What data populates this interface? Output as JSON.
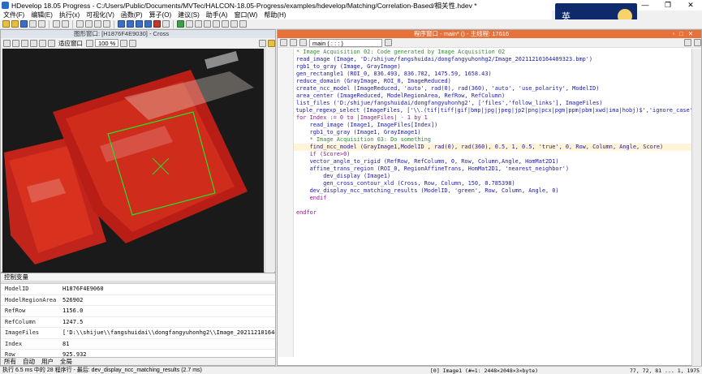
{
  "window": {
    "title": "HDevelop 18.05 Progress - C:/Users/Public/Documents/MVTec/HALCON-18.05-Progress/examples/hdevelop/Matching/Correlation-Based/相关性.hdev *",
    "controls": [
      "—",
      "❐",
      "✕"
    ]
  },
  "menu": [
    "文件(F)",
    "编辑(E)",
    "执行(x)",
    "可视化(V)",
    "函数(P)",
    "算子(O)",
    "建议(S)",
    "助手(A)",
    "窗口(W)",
    "帮助(H)"
  ],
  "ime": {
    "label": "英"
  },
  "graphics": {
    "title": "图形窗口: [H1876F4E9030] - Cross",
    "fit_label": "适应窗口",
    "zoom": "100 %"
  },
  "variables": {
    "title": "控制变量",
    "rows": [
      {
        "name": "ModelID",
        "value": "H1876F4E9060"
      },
      {
        "name": "ModelRegionArea",
        "value": "526902"
      },
      {
        "name": "RefRow",
        "value": "1156.0"
      },
      {
        "name": "RefColumn",
        "value": "1247.5"
      },
      {
        "name": "ImageFiles",
        "value": "['D:\\\\shijue\\\\fangshuidai\\\\dongfangyuhonhg2\\\\Image_20211210164409"
      },
      {
        "name": "Index",
        "value": "81"
      },
      {
        "name": "Row",
        "value": "925.932"
      }
    ],
    "tabs": [
      "所有",
      "自动",
      "用户",
      "全局"
    ]
  },
  "program": {
    "title": "程序窗口 - main* () - 主线程: 17616",
    "procedure": "main ( : : : )",
    "lines": [
      {
        "n": "1",
        "text": "* Image Acquisition 02: Code generated by Image Acquisition 02",
        "style": "comment"
      },
      {
        "n": "2",
        "text": "read_image (Image, 'D:/shijue/fangshuidai/dongfangyuhonhg2/Image_20211210164409323.bmp')",
        "style": ""
      },
      {
        "n": "3",
        "text": "rgb1_to_gray (Image, GrayImage)",
        "style": ""
      },
      {
        "n": "4",
        "text": "gen_rectangle1 (ROI_0, 836.493, 836.702, 1475.59, 1658.43)",
        "style": ""
      },
      {
        "n": "5",
        "text": "reduce_domain (GrayImage, ROI_0, ImageReduced)",
        "style": ""
      },
      {
        "n": "6",
        "text": "create_ncc_model (ImageReduced, 'auto', rad(0), rad(360), 'auto', 'use_polarity', ModelID)",
        "style": ""
      },
      {
        "n": "7",
        "text": "area_center (ImageReduced, ModelRegionArea, RefRow, RefColumn)",
        "style": ""
      },
      {
        "n": "8",
        "text": "list_files ('D:/shijue/fangshuidai/dongfangyuhonhg2', ['files','follow_links'], ImageFiles)",
        "style": ""
      },
      {
        "n": "9",
        "text": "tuple_regexp_select (ImageFiles, ['\\\\.(tif|tiff|gif|bmp|jpg|jpeg|jp2|png|pcx|pgm|ppm|pbm|xwd|ima|hobj)$','ignore_case'], Im",
        "style": ""
      },
      {
        "n": "10",
        "text": "for Index := 0 to |ImageFiles| - 1 by 1",
        "style": "kw"
      },
      {
        "n": "11",
        "text": "    read_image (Image1, ImageFiles[Index])",
        "style": ""
      },
      {
        "n": "12",
        "text": "    rgb1_to_gray (Image1, GrayImage1)",
        "style": ""
      },
      {
        "n": "13",
        "text": "    * Image Acquisition 03: Do something",
        "style": "comment"
      },
      {
        "n": "14",
        "text": "    find_ncc_model (GrayImage1,ModelID , rad(0), rad(360), 0.5, 1, 0.5, 'true', 0, Row, Column, Angle, Score)",
        "style": "hl"
      },
      {
        "n": "15",
        "text": "    if (Score>0)",
        "style": "kw"
      },
      {
        "n": "16",
        "text": "    vector_angle_to_rigid (RefRow, RefColumn, 0, Row, Column,Angle, HomMat2D1)",
        "style": ""
      },
      {
        "n": "17",
        "text": "    affine_trans_region (ROI_0, RegionAffineTrans, HomMat2D1, 'nearest_neighbor')",
        "style": ""
      },
      {
        "n": "18",
        "text": "        dev_display (Image1)",
        "style": ""
      },
      {
        "n": "19",
        "text": "        gen_cross_contour_xld (Cross, Row, Column, 150, 0.785398)",
        "style": ""
      },
      {
        "n": "20",
        "text": "    dev_display_ncc_matching_results (ModelID, 'green', Row, Column, Angle, 0)",
        "style": ""
      },
      {
        "n": "21",
        "text": "    endif",
        "style": "kw"
      },
      {
        "n": "22",
        "text": "",
        "style": ""
      },
      {
        "n": "23",
        "text": "endfor",
        "style": "kw"
      },
      {
        "n": "24",
        "text": "",
        "style": ""
      }
    ]
  },
  "status": {
    "left": "执行 6.5 ms 中的 28 程序行 - 最后: dev_display_ncc_matching_results (2.7 ms)",
    "image_info": "[0] Image1 (#=1: 2448×2048×3×byte)",
    "coords": "77, 72, 81   ...   1, 1975"
  }
}
